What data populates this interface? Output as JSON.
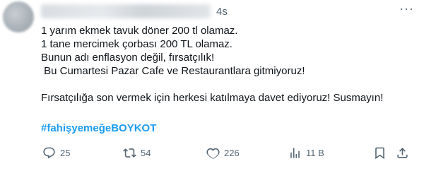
{
  "header": {
    "time": "4s",
    "more": "···"
  },
  "tweet": {
    "lines": [
      "1 yarım ekmek tavuk döner 200 tl olamaz.",
      "1 tane mercimek çorbası 200 TL olamaz.",
      "Bunun adı enflasyon değil, fırsatçılık!",
      " Bu Cumartesi Pazar Cafe ve Restaurantlara gitmiyoruz!",
      "",
      "Fırsatçılığa son vermek için herkesi katılmaya davet ediyoruz! Susmayın!"
    ],
    "hashtag": "#fahişyemeğeBOYKOT"
  },
  "actions": {
    "replies": "25",
    "retweets": "54",
    "likes": "226",
    "views": "11 B"
  },
  "icons": {
    "reply": "reply-icon",
    "retweet": "retweet-icon",
    "like": "heart-icon",
    "views": "views-icon",
    "bookmark": "bookmark-icon",
    "share": "share-icon"
  },
  "colors": {
    "hashtag": "#1d9bf0",
    "secondary": "#536471",
    "text": "#0f1419"
  }
}
